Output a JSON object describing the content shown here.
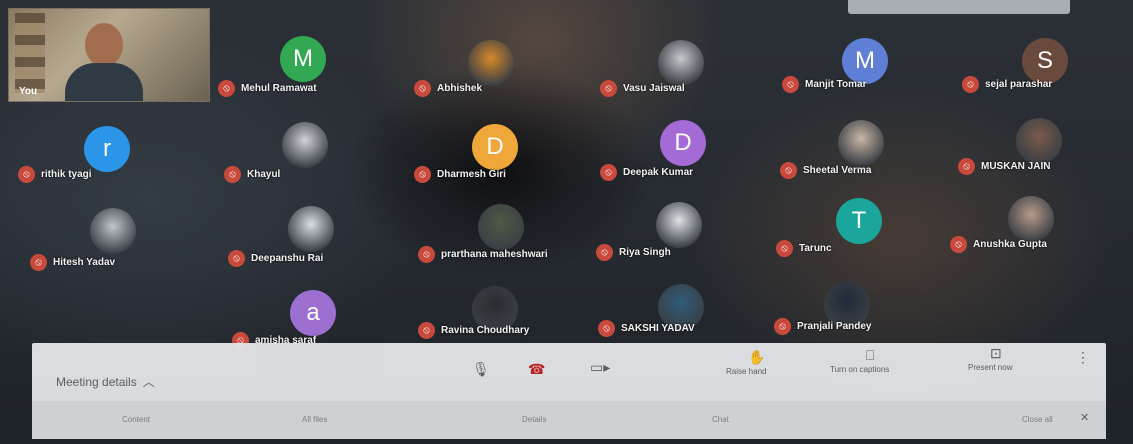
{
  "self": {
    "label": "You"
  },
  "participants": [
    {
      "name": "Mehul Ramawat",
      "initial": "M",
      "kind": "letter",
      "color": "#33a852"
    },
    {
      "name": "Abhishek",
      "initial": "",
      "kind": "photo",
      "color": "#d8882a"
    },
    {
      "name": "Vasu Jaiswal",
      "initial": "",
      "kind": "photo",
      "color": "#c7c9cc"
    },
    {
      "name": "Manjit Tomar",
      "initial": "M",
      "kind": "letter",
      "color": "#5f7fd6"
    },
    {
      "name": "sejal parashar",
      "initial": "S",
      "kind": "letter",
      "color": "#6a4a3c"
    },
    {
      "name": "rithik tyagi",
      "initial": "r",
      "kind": "letter",
      "color": "#2b96e8"
    },
    {
      "name": "Khayul",
      "initial": "",
      "kind": "photo",
      "color": "#cfd3d6"
    },
    {
      "name": "Dharmesh Giri",
      "initial": "D",
      "kind": "letter",
      "color": "#f0a73a"
    },
    {
      "name": "Deepak Kumar",
      "initial": "D",
      "kind": "letter",
      "color": "#a46ad6"
    },
    {
      "name": "Sheetal Verma",
      "initial": "",
      "kind": "photo",
      "color": "#c9b6a6"
    },
    {
      "name": "MUSKAN JAIN",
      "initial": "",
      "kind": "photo",
      "color": "#7b5a4a"
    },
    {
      "name": "Hitesh Yadav",
      "initial": "",
      "kind": "photo",
      "color": "#bfc6cc"
    },
    {
      "name": "Deepanshu Rai",
      "initial": "",
      "kind": "photo",
      "color": "#d9dee3"
    },
    {
      "name": "prarthana maheshwari",
      "initial": "",
      "kind": "photo",
      "color": "#4d5a44"
    },
    {
      "name": "Riya Singh",
      "initial": "",
      "kind": "photo",
      "color": "#dfe3e6"
    },
    {
      "name": "Tarunc",
      "initial": "T",
      "kind": "letter",
      "color": "#1aa69a"
    },
    {
      "name": "Anushka Gupta",
      "initial": "",
      "kind": "photo",
      "color": "#b79a8a"
    },
    {
      "name": "amisha saraf",
      "initial": "a",
      "kind": "letter",
      "color": "#9c6fd0"
    },
    {
      "name": "Ravina Choudhary",
      "initial": "",
      "kind": "photo",
      "color": "#2c2c30"
    },
    {
      "name": "SAKSHI YADAV",
      "initial": "",
      "kind": "photo",
      "color": "#2d5d7a"
    },
    {
      "name": "Pranjali Pandey",
      "initial": "",
      "kind": "photo",
      "color": "#1f2a3a"
    }
  ],
  "bottom_bar": {
    "meeting_details": "Meeting details",
    "raise_hand": "Raise hand",
    "captions": "Turn on captions",
    "present": "Present now",
    "strip": [
      "Content",
      "All files",
      "Details",
      "Chat",
      "Close all"
    ]
  },
  "icons": {
    "mute": "mic-off-icon",
    "mic": "mic-icon",
    "hangup": "call-end-icon",
    "camera": "camera-icon",
    "hand": "raise-hand-icon",
    "cc": "captions-icon",
    "present": "present-icon",
    "more": "more-vert-icon"
  }
}
